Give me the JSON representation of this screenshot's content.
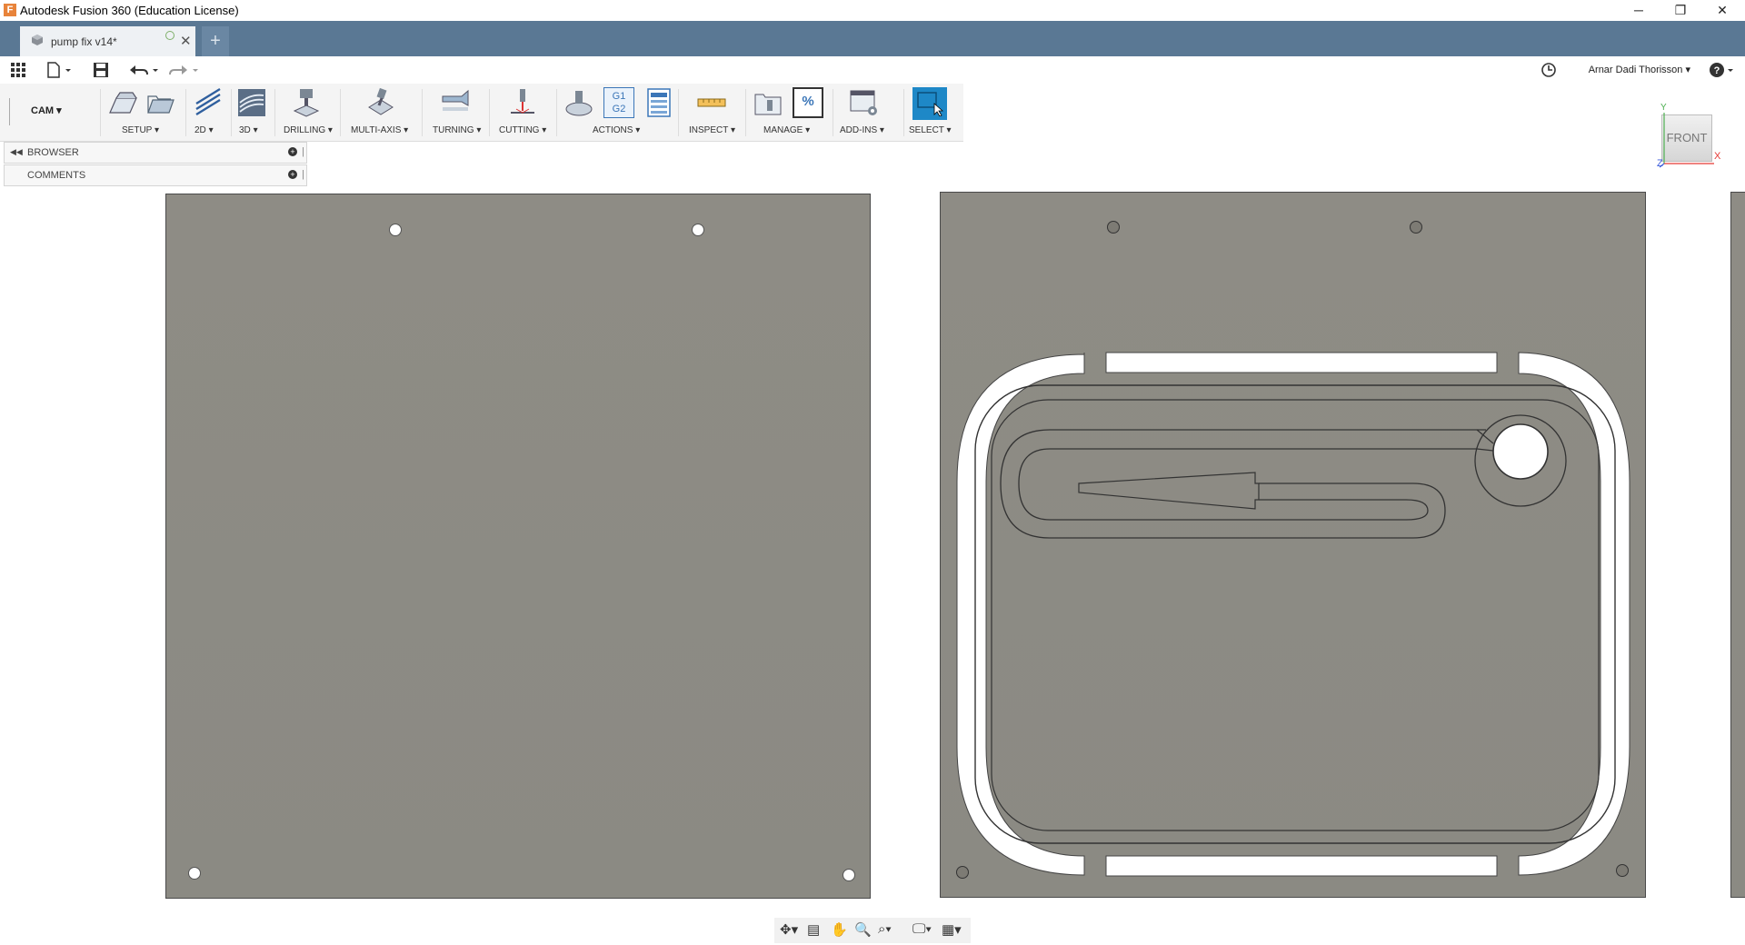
{
  "window": {
    "title": "Autodesk Fusion 360 (Education License)",
    "app_icon": "F",
    "controls": {
      "minimize": "─",
      "restore": "❐",
      "close": "✕"
    }
  },
  "tabs": [
    {
      "label": "pump fix v14*",
      "active": true
    }
  ],
  "new_tab_label": "+",
  "quick_access": {
    "user_name": "Arnar Dadi Thorisson",
    "icons": [
      "grid-icon",
      "file-icon",
      "save-icon",
      "undo-icon",
      "redo-icon",
      "job-status-icon",
      "help-icon"
    ]
  },
  "toolbar": {
    "workspace": "CAM",
    "groups": [
      {
        "label": "SETUP"
      },
      {
        "label": "2D"
      },
      {
        "label": "3D"
      },
      {
        "label": "DRILLING"
      },
      {
        "label": "MULTI-AXIS"
      },
      {
        "label": "TURNING"
      },
      {
        "label": "CUTTING"
      },
      {
        "label": "ACTIONS"
      },
      {
        "label": "INSPECT"
      },
      {
        "label": "MANAGE"
      },
      {
        "label": "ADD-INS"
      },
      {
        "label": "SELECT"
      }
    ],
    "actions_g_label_1": "G1",
    "actions_g_label_2": "G2",
    "manage_percent": "%"
  },
  "panels": {
    "browser": "BROWSER",
    "comments": "COMMENTS"
  },
  "viewcube": {
    "face": "FRONT",
    "axes": {
      "x": "X",
      "y": "Y",
      "z": "Z"
    }
  },
  "colors": {
    "tabbar": "#5a7894",
    "plate": "#8d8b84",
    "select_blue": "#1e88c7"
  }
}
